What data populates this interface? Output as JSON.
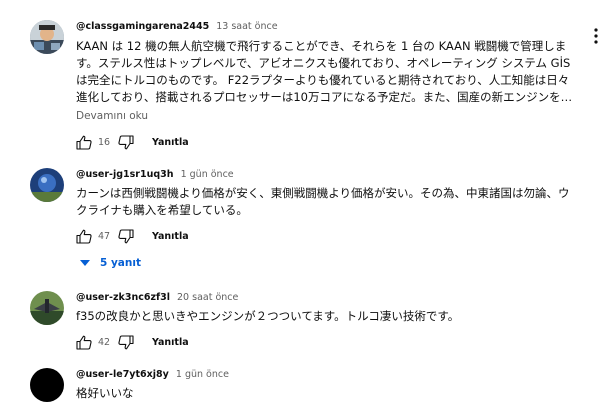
{
  "comments": [
    {
      "author": "@classgamingarena2445",
      "time": "13 saat önce",
      "lines": [
        "KAAN は 12 機の無人航空機で飛行することができ、それらを 1 台の KAAN 戦闘機で管理しま",
        "す。ステルス性はトップレベルで、アビオニクスも優れており、オペレーティング システム GİS",
        "は完全にトルコのものです。 F22ラプターよりも優れていると期待されており、人工知能は日々",
        "進化しており、搭載されるプロセッサーは10万コアになる予定だ。また、国産の新エンジンを…"
      ],
      "read_more": "Devamını oku",
      "likes": "16",
      "reply_label": "Yanıtla"
    },
    {
      "author": "@user-jg1sr1uq3h",
      "time": "1 gün önce",
      "lines": [
        "カーンは西側戦闘機より価格が安く、東側戦闘機より価格が安い。その為、中東諸国は勿論、ウ",
        "クライナも購入を希望している。"
      ],
      "likes": "47",
      "reply_label": "Yanıtla",
      "replies_label": "5 yanıt"
    },
    {
      "author": "@user-zk3nc6zf3l",
      "time": "20 saat önce",
      "lines": [
        "f35の改良かと思いきやエンジンが２つついてます。トルコ凄い技術です。"
      ],
      "likes": "42",
      "reply_label": "Yanıtla"
    },
    {
      "author": "@user-le7yt6xj8y",
      "time": "1 gün önce",
      "lines": [
        "格好いいな"
      ]
    }
  ],
  "icons": {
    "like": "thumbs-up-icon",
    "dislike": "thumbs-down-icon",
    "menu": "more-vert-icon",
    "expand": "chevron-down-icon"
  },
  "colors": {
    "link_blue": "#065fd4",
    "secondary_text": "#606060"
  }
}
